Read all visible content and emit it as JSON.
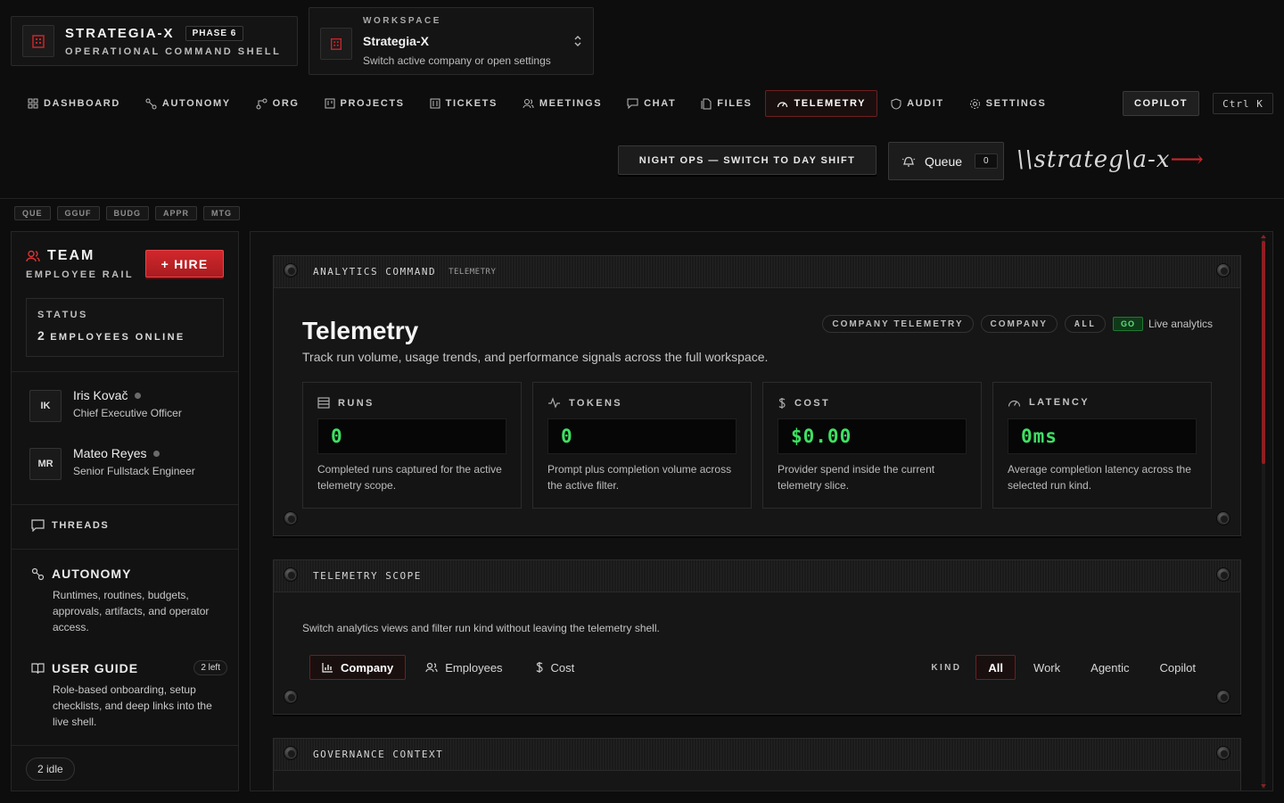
{
  "brand": {
    "title": "STRATEGIA-X",
    "phase": "PHASE 6",
    "subtitle": "OPERATIONAL COMMAND SHELL"
  },
  "workspace": {
    "label": "WORKSPACE",
    "name": "Strategia-X",
    "sub": "Switch active company or open settings"
  },
  "nav": [
    {
      "label": "DASHBOARD",
      "icon": "grid-icon"
    },
    {
      "label": "AUTONOMY",
      "icon": "nodes-icon"
    },
    {
      "label": "ORG",
      "icon": "org-icon"
    },
    {
      "label": "PROJECTS",
      "icon": "board-icon"
    },
    {
      "label": "TICKETS",
      "icon": "ticket-icon"
    },
    {
      "label": "MEETINGS",
      "icon": "users-icon"
    },
    {
      "label": "CHAT",
      "icon": "chat-icon"
    },
    {
      "label": "FILES",
      "icon": "files-icon"
    },
    {
      "label": "TELEMETRY",
      "icon": "gauge-icon",
      "active": true
    },
    {
      "label": "AUDIT",
      "icon": "shield-icon"
    },
    {
      "label": "SETTINGS",
      "icon": "gear-icon"
    }
  ],
  "copilot": "COPILOT",
  "shortcut": "Ctrl K",
  "shift_button": "NIGHT OPS — SWITCH TO DAY SHIFT",
  "queue": {
    "label": "Queue",
    "count": "0"
  },
  "logo_text": "\\\\strateg\\a-x",
  "chips": [
    "QUE",
    "GGUF",
    "BUDG",
    "APPR",
    "MTG"
  ],
  "sidebar": {
    "title": "TEAM",
    "subtitle": "EMPLOYEE RAIL",
    "hire": "+ HIRE",
    "status_label": "STATUS",
    "status_count": "2",
    "status_text": "EMPLOYEES ONLINE",
    "employees": [
      {
        "initials": "IK",
        "name": "Iris Kovač",
        "role": "Chief Executive Officer"
      },
      {
        "initials": "MR",
        "name": "Mateo Reyes",
        "role": "Senior Fullstack Engineer"
      }
    ],
    "threads": "THREADS",
    "autonomy": {
      "title": "AUTONOMY",
      "desc": "Runtimes, routines, budgets, approvals, artifacts, and operator access."
    },
    "guide": {
      "title": "USER GUIDE",
      "badge": "2 left",
      "desc": "Role-based onboarding, setup checklists, and deep links into the live shell."
    },
    "idle": "2 idle"
  },
  "analytics": {
    "panel_title": "ANALYTICS COMMAND",
    "panel_tag": "TELEMETRY",
    "title": "Telemetry",
    "subtitle": "Track run volume, usage trends, and performance signals across the full workspace.",
    "pills": [
      "COMPANY TELEMETRY",
      "COMPANY",
      "ALL"
    ],
    "go": "GO",
    "live": "Live analytics",
    "metrics": [
      {
        "label": "RUNS",
        "icon": "list-icon",
        "value": "0",
        "desc": "Completed runs captured for the active telemetry scope."
      },
      {
        "label": "TOKENS",
        "icon": "pulse-icon",
        "value": "0",
        "desc": "Prompt plus completion volume across the active filter."
      },
      {
        "label": "COST",
        "icon": "dollar-icon",
        "value": "$0.00",
        "desc": "Provider spend inside the current telemetry slice."
      },
      {
        "label": "LATENCY",
        "icon": "gauge-icon",
        "value": "0ms",
        "desc": "Average completion latency across the selected run kind."
      }
    ]
  },
  "scope": {
    "panel_title": "TELEMETRY SCOPE",
    "desc": "Switch analytics views and filter run kind without leaving the telemetry shell.",
    "views": [
      "Company",
      "Employees",
      "Cost"
    ],
    "kind_label": "KIND",
    "kinds": [
      "All",
      "Work",
      "Agentic",
      "Copilot"
    ]
  },
  "governance": {
    "panel_title": "GOVERNANCE CONTEXT"
  },
  "colors": {
    "accent": "#c9252b",
    "screen_green": "#3ee063",
    "background": "#0d0d0d"
  }
}
